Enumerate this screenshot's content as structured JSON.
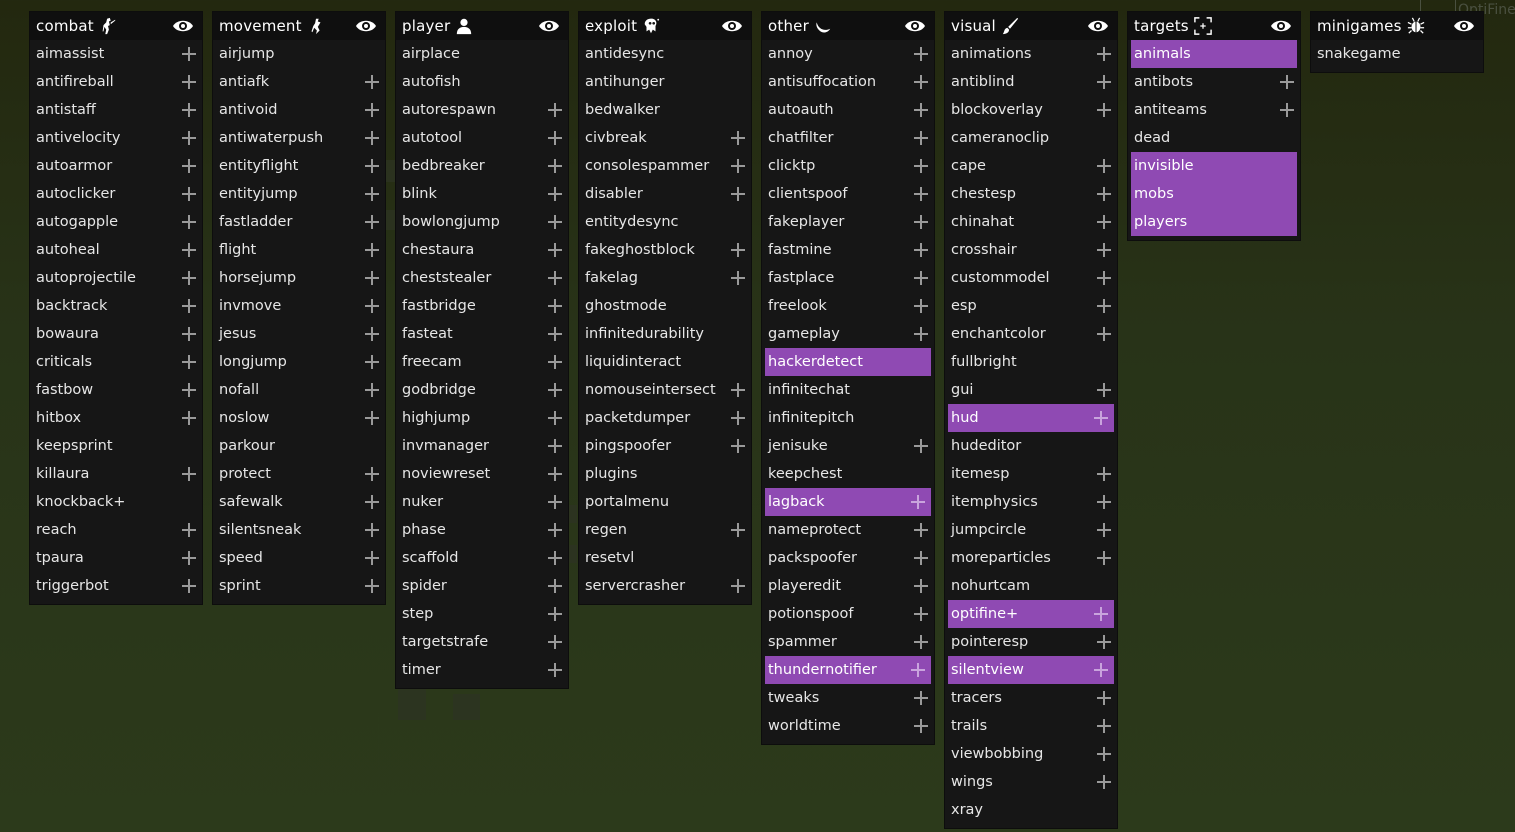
{
  "panels": [
    {
      "title": "combat",
      "icon": "soldier-icon",
      "items": [
        {
          "label": "aimassist",
          "settings": true
        },
        {
          "label": "antifireball",
          "settings": true
        },
        {
          "label": "antistaff",
          "settings": true
        },
        {
          "label": "antivelocity",
          "settings": true
        },
        {
          "label": "autoarmor",
          "settings": true
        },
        {
          "label": "autoclicker",
          "settings": true
        },
        {
          "label": "autogapple",
          "settings": true
        },
        {
          "label": "autoheal",
          "settings": true
        },
        {
          "label": "autoprojectile",
          "settings": true
        },
        {
          "label": "backtrack",
          "settings": true
        },
        {
          "label": "bowaura",
          "settings": true
        },
        {
          "label": "criticals",
          "settings": true
        },
        {
          "label": "fastbow",
          "settings": true
        },
        {
          "label": "hitbox",
          "settings": true
        },
        {
          "label": "keepsprint",
          "settings": false
        },
        {
          "label": "killaura",
          "settings": true
        },
        {
          "label": "knockback+",
          "settings": false
        },
        {
          "label": "reach",
          "settings": true
        },
        {
          "label": "tpaura",
          "settings": true
        },
        {
          "label": "triggerbot",
          "settings": true
        }
      ]
    },
    {
      "title": "movement",
      "icon": "running-icon",
      "items": [
        {
          "label": "airjump",
          "settings": false
        },
        {
          "label": "antiafk",
          "settings": true
        },
        {
          "label": "antivoid",
          "settings": true
        },
        {
          "label": "antiwaterpush",
          "settings": true
        },
        {
          "label": "entityflight",
          "settings": true
        },
        {
          "label": "entityjump",
          "settings": true
        },
        {
          "label": "fastladder",
          "settings": true
        },
        {
          "label": "flight",
          "settings": true
        },
        {
          "label": "horsejump",
          "settings": true
        },
        {
          "label": "invmove",
          "settings": true
        },
        {
          "label": "jesus",
          "settings": true
        },
        {
          "label": "longjump",
          "settings": true
        },
        {
          "label": "nofall",
          "settings": true
        },
        {
          "label": "noslow",
          "settings": true
        },
        {
          "label": "parkour",
          "settings": false
        },
        {
          "label": "protect",
          "settings": true
        },
        {
          "label": "safewalk",
          "settings": true
        },
        {
          "label": "silentsneak",
          "settings": true
        },
        {
          "label": "speed",
          "settings": true
        },
        {
          "label": "sprint",
          "settings": true
        }
      ]
    },
    {
      "title": "player",
      "icon": "user-icon",
      "items": [
        {
          "label": "airplace",
          "settings": false
        },
        {
          "label": "autofish",
          "settings": false
        },
        {
          "label": "autorespawn",
          "settings": true
        },
        {
          "label": "autotool",
          "settings": true
        },
        {
          "label": "bedbreaker",
          "settings": true
        },
        {
          "label": "blink",
          "settings": true
        },
        {
          "label": "bowlongjump",
          "settings": true
        },
        {
          "label": "chestaura",
          "settings": true
        },
        {
          "label": "cheststealer",
          "settings": true
        },
        {
          "label": "fastbridge",
          "settings": true
        },
        {
          "label": "fasteat",
          "settings": true
        },
        {
          "label": "freecam",
          "settings": true
        },
        {
          "label": "godbridge",
          "settings": true
        },
        {
          "label": "highjump",
          "settings": true
        },
        {
          "label": "invmanager",
          "settings": true
        },
        {
          "label": "noviewreset",
          "settings": true
        },
        {
          "label": "nuker",
          "settings": true
        },
        {
          "label": "phase",
          "settings": true
        },
        {
          "label": "scaffold",
          "settings": true
        },
        {
          "label": "spider",
          "settings": true
        },
        {
          "label": "step",
          "settings": true
        },
        {
          "label": "targetstrafe",
          "settings": true
        },
        {
          "label": "timer",
          "settings": true
        }
      ]
    },
    {
      "title": "exploit",
      "icon": "ghost-icon",
      "items": [
        {
          "label": "antidesync",
          "settings": false
        },
        {
          "label": "antihunger",
          "settings": false
        },
        {
          "label": "bedwalker",
          "settings": false
        },
        {
          "label": "civbreak",
          "settings": true
        },
        {
          "label": "consolespammer",
          "settings": true
        },
        {
          "label": "disabler",
          "settings": true
        },
        {
          "label": "entitydesync",
          "settings": false
        },
        {
          "label": "fakeghostblock",
          "settings": true
        },
        {
          "label": "fakelag",
          "settings": true
        },
        {
          "label": "ghostmode",
          "settings": false
        },
        {
          "label": "infinitedurability",
          "settings": false
        },
        {
          "label": "liquidinteract",
          "settings": false
        },
        {
          "label": "nomouseintersect",
          "settings": true
        },
        {
          "label": "packetdumper",
          "settings": true
        },
        {
          "label": "pingspoofer",
          "settings": true
        },
        {
          "label": "plugins",
          "settings": false
        },
        {
          "label": "portalmenu",
          "settings": false
        },
        {
          "label": "regen",
          "settings": true
        },
        {
          "label": "resetvl",
          "settings": false
        },
        {
          "label": "servercrasher",
          "settings": true
        }
      ]
    },
    {
      "title": "other",
      "icon": "moon-icon",
      "items": [
        {
          "label": "annoy",
          "settings": true
        },
        {
          "label": "antisuffocation",
          "settings": true
        },
        {
          "label": "autoauth",
          "settings": true
        },
        {
          "label": "chatfilter",
          "settings": true
        },
        {
          "label": "clicktp",
          "settings": true
        },
        {
          "label": "clientspoof",
          "settings": true
        },
        {
          "label": "fakeplayer",
          "settings": true
        },
        {
          "label": "fastmine",
          "settings": true
        },
        {
          "label": "fastplace",
          "settings": true
        },
        {
          "label": "freelook",
          "settings": true
        },
        {
          "label": "gameplay",
          "settings": true
        },
        {
          "label": "hackerdetect",
          "settings": false,
          "active": true
        },
        {
          "label": "infinitechat",
          "settings": false
        },
        {
          "label": "infinitepitch",
          "settings": false
        },
        {
          "label": "jenisuke",
          "settings": true
        },
        {
          "label": "keepchest",
          "settings": false
        },
        {
          "label": "lagback",
          "settings": true,
          "active": true
        },
        {
          "label": "nameprotect",
          "settings": true
        },
        {
          "label": "packspoofer",
          "settings": true
        },
        {
          "label": "playeredit",
          "settings": true
        },
        {
          "label": "potionspoof",
          "settings": true
        },
        {
          "label": "spammer",
          "settings": true
        },
        {
          "label": "thundernotifier",
          "settings": true,
          "active": true
        },
        {
          "label": "tweaks",
          "settings": true
        },
        {
          "label": "worldtime",
          "settings": true
        }
      ]
    },
    {
      "title": "visual",
      "icon": "brush-icon",
      "items": [
        {
          "label": "animations",
          "settings": true
        },
        {
          "label": "antiblind",
          "settings": true
        },
        {
          "label": "blockoverlay",
          "settings": true
        },
        {
          "label": "cameranoclip",
          "settings": false
        },
        {
          "label": "cape",
          "settings": true
        },
        {
          "label": "chestesp",
          "settings": true
        },
        {
          "label": "chinahat",
          "settings": true
        },
        {
          "label": "crosshair",
          "settings": true
        },
        {
          "label": "custommodel",
          "settings": true
        },
        {
          "label": "esp",
          "settings": true
        },
        {
          "label": "enchantcolor",
          "settings": true
        },
        {
          "label": "fullbright",
          "settings": false
        },
        {
          "label": "gui",
          "settings": true
        },
        {
          "label": "hud",
          "settings": true,
          "active": true
        },
        {
          "label": "hudeditor",
          "settings": false
        },
        {
          "label": "itemesp",
          "settings": true
        },
        {
          "label": "itemphysics",
          "settings": true
        },
        {
          "label": "jumpcircle",
          "settings": true
        },
        {
          "label": "moreparticles",
          "settings": true
        },
        {
          "label": "nohurtcam",
          "settings": false
        },
        {
          "label": "optifine+",
          "settings": true,
          "active": true
        },
        {
          "label": "pointeresp",
          "settings": true
        },
        {
          "label": "silentview",
          "settings": true,
          "active": true
        },
        {
          "label": "tracers",
          "settings": true
        },
        {
          "label": "trails",
          "settings": true
        },
        {
          "label": "viewbobbing",
          "settings": true
        },
        {
          "label": "wings",
          "settings": true
        },
        {
          "label": "xray",
          "settings": false
        }
      ]
    },
    {
      "title": "targets",
      "icon": "target-frame-icon",
      "items": [
        {
          "label": "animals",
          "settings": false,
          "active": true
        },
        {
          "label": "antibots",
          "settings": true
        },
        {
          "label": "antiteams",
          "settings": true
        },
        {
          "label": "dead",
          "settings": false
        },
        {
          "label": "invisible",
          "settings": false,
          "active": true
        },
        {
          "label": "mobs",
          "settings": false,
          "active": true
        },
        {
          "label": "players",
          "settings": false,
          "active": true
        }
      ]
    },
    {
      "title": "minigames",
      "icon": "bug-icon",
      "items": [
        {
          "label": "snakegame",
          "settings": false
        }
      ]
    }
  ],
  "background_text": "OptiFine",
  "colors": {
    "accent": "#8f4ab3",
    "panel": "#161616",
    "header": "#0f0f0f",
    "text": "#e6e6e6"
  }
}
